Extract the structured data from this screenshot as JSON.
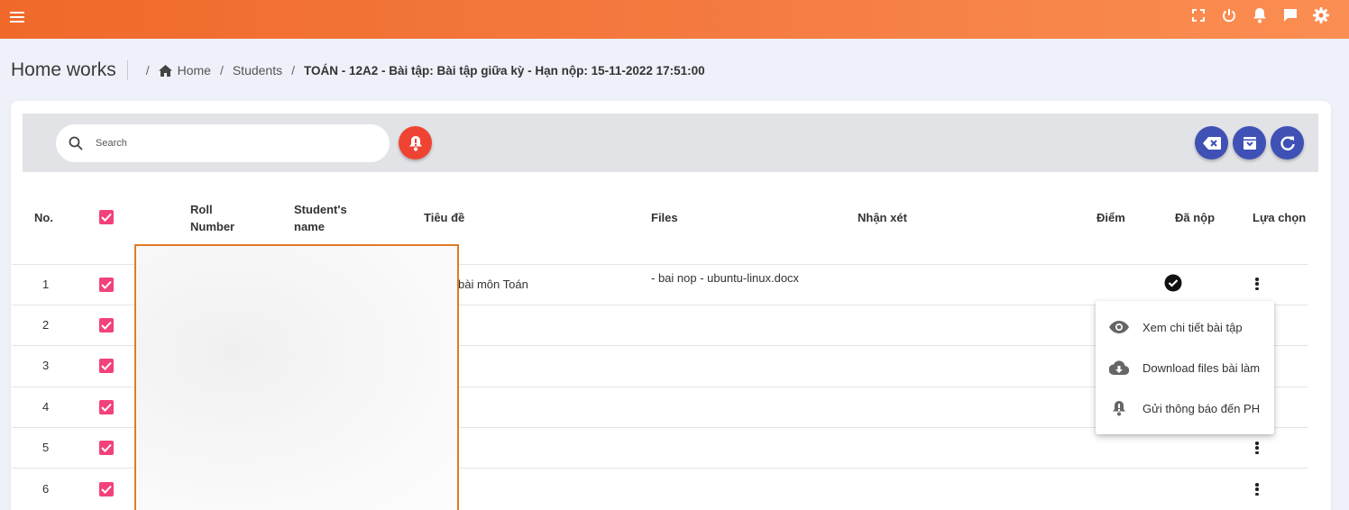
{
  "header": {
    "icons": [
      "menu-icon",
      "fullscreen-icon",
      "power-icon",
      "bell-icon",
      "chat-icon",
      "settings-icon"
    ]
  },
  "page": {
    "title": "Home works",
    "breadcrumb": {
      "home": "Home",
      "students": "Students",
      "current": "TOÁN - 12A2 - Bài tập: Bài tập giữa kỳ - Hạn nộp: 15-11-2022 17:51:00"
    }
  },
  "toolbar": {
    "search_placeholder": "Search",
    "buttons": [
      "notify-bell",
      "clear",
      "archive",
      "refresh"
    ]
  },
  "table": {
    "headers": {
      "no": "No.",
      "roll_1": "Roll",
      "roll_2": "Number",
      "name_1": "Student's",
      "name_2": "name",
      "title": "Tiêu đề",
      "files": "Files",
      "comment": "Nhận xét",
      "score": "Điểm",
      "submitted": "Đã nộp",
      "options": "Lựa chọn"
    },
    "rows": [
      {
        "no": "1",
        "title_visible": "bài môn Toán",
        "files": "- bai nop - ubuntu-linux.docx",
        "submitted": true
      },
      {
        "no": "2"
      },
      {
        "no": "3"
      },
      {
        "no": "4"
      },
      {
        "no": "5"
      },
      {
        "no": "6"
      }
    ]
  },
  "context_menu": {
    "items": [
      {
        "label": "Xem chi tiết bài tập",
        "icon": "eye-icon"
      },
      {
        "label": "Download files bài làm",
        "icon": "cloud-download-icon"
      },
      {
        "label": "Gửi thông báo đến PH",
        "icon": "bell-icon"
      }
    ]
  },
  "colors": {
    "header_start": "#f0692b",
    "header_end": "#fb8e52",
    "accent_blue": "#3f51b5",
    "checkbox_pink": "#f2427a",
    "alert_red": "#f04433",
    "highlight_orange": "#e07b25"
  }
}
